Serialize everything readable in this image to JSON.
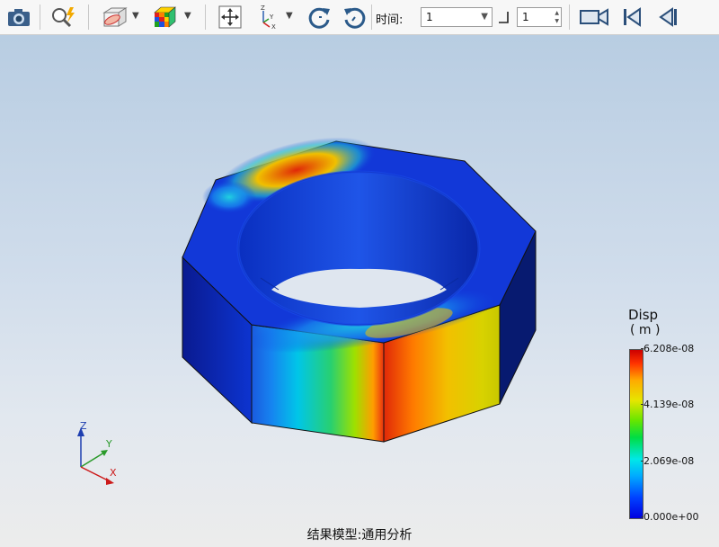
{
  "toolbar": {
    "buttons": [
      {
        "name": "screenshot-button",
        "icon": "camera-icon"
      },
      {
        "name": "zoom-fit-button",
        "icon": "magnifier-lightning-icon"
      },
      {
        "name": "clip-view-button",
        "icon": "box-section-icon"
      },
      {
        "name": "display-mode-button",
        "icon": "colored-cube-icon"
      },
      {
        "name": "pan-button",
        "icon": "move-arrows-icon"
      },
      {
        "name": "view-axis-button",
        "icon": "xyz-axes-icon"
      },
      {
        "name": "rotate-ccw-button",
        "icon": "rotate-left-icon"
      },
      {
        "name": "rotate-cw-button",
        "icon": "rotate-right-icon"
      },
      {
        "name": "record-video-button",
        "icon": "video-camera-icon"
      },
      {
        "name": "first-frame-button",
        "icon": "skip-first-icon"
      },
      {
        "name": "previous-frame-button",
        "icon": "step-back-icon"
      }
    ],
    "time_label": "时间:",
    "time_value": "1",
    "step_value": "1"
  },
  "legend": {
    "title": "Disp",
    "unit": "( m )",
    "ticks": [
      "6.208e-08",
      "4.139e-08",
      "2.069e-08",
      "0.000e+00"
    ]
  },
  "axes": {
    "x": "X",
    "y": "Y",
    "z": "Z"
  },
  "caption": "结果模型:通用分析"
}
